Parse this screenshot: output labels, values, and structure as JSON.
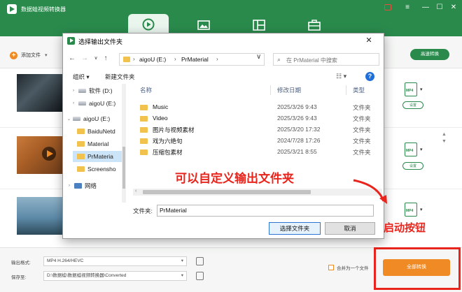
{
  "app": {
    "title": "数据蛙视频转换器",
    "accent": "#2a8a4c",
    "orange": "#f08a24"
  },
  "nav_tabs": [
    {
      "icon": "convert-icon",
      "active": true
    },
    {
      "icon": "image-icon",
      "active": false
    },
    {
      "icon": "layout-icon",
      "active": false
    },
    {
      "icon": "toolbox-icon",
      "active": false
    }
  ],
  "toolbar": {
    "add_file": "添加文件",
    "fast_convert": "高速转换"
  },
  "rows": [
    {
      "format": "MP4",
      "settings": "设置"
    },
    {
      "format": "MP4",
      "settings": "设置"
    },
    {
      "format": "MP4",
      "settings": "设置"
    }
  ],
  "bottom": {
    "output_format_label": "输出格式:",
    "output_format_value": "MP4 H.264/HEVC",
    "save_to_label": "保存至:",
    "save_to_value": "D:\\数据蛙\\数据蛙视频转换器\\Converted",
    "merge_label": "合并为一个文件",
    "convert_all": "全部转换"
  },
  "dialog": {
    "title": "选择输出文件夹",
    "close": "✕",
    "address": {
      "drive": "aigoU (E:)",
      "folder": "PrMaterial"
    },
    "search_placeholder": "在 PrMaterial 中搜索",
    "organize": "组织 ▾",
    "new_folder": "新建文件夹",
    "tree": [
      {
        "label": "软件 (D:)",
        "type": "drive",
        "indent": 1
      },
      {
        "label": "aigoU (E:)",
        "type": "drive",
        "indent": 1
      },
      {
        "label": "aigoU (E:)",
        "type": "drive",
        "indent": 0
      },
      {
        "label": "BaiduNetd",
        "type": "folder",
        "indent": 1
      },
      {
        "label": "Material",
        "type": "folder",
        "indent": 1
      },
      {
        "label": "PrMateria",
        "type": "folder",
        "indent": 1,
        "selected": true
      },
      {
        "label": "Screensho",
        "type": "folder",
        "indent": 1
      },
      {
        "label": "网络",
        "type": "net",
        "indent": 0
      }
    ],
    "columns": {
      "name": "名称",
      "date": "修改日期",
      "type": "类型"
    },
    "files": [
      {
        "name": "Music",
        "date": "2025/3/26 9:43",
        "type": "文件夹"
      },
      {
        "name": "Video",
        "date": "2025/3/26 9:43",
        "type": "文件夹"
      },
      {
        "name": "图片与视频素材",
        "date": "2025/3/20 17:32",
        "type": "文件夹"
      },
      {
        "name": "戏为六绝句",
        "date": "2024/7/28 17:26",
        "type": "文件夹"
      },
      {
        "name": "压缩包素材",
        "date": "2025/3/21 8:55",
        "type": "文件夹"
      }
    ],
    "folder_label": "文件夹:",
    "folder_value": "PrMaterial",
    "select_button": "选择文件夹",
    "cancel_button": "取消"
  },
  "annotations": {
    "custom_folder": "可以自定义输出文件夹",
    "start_button": "启动按钮",
    "color": "#e8241c"
  }
}
